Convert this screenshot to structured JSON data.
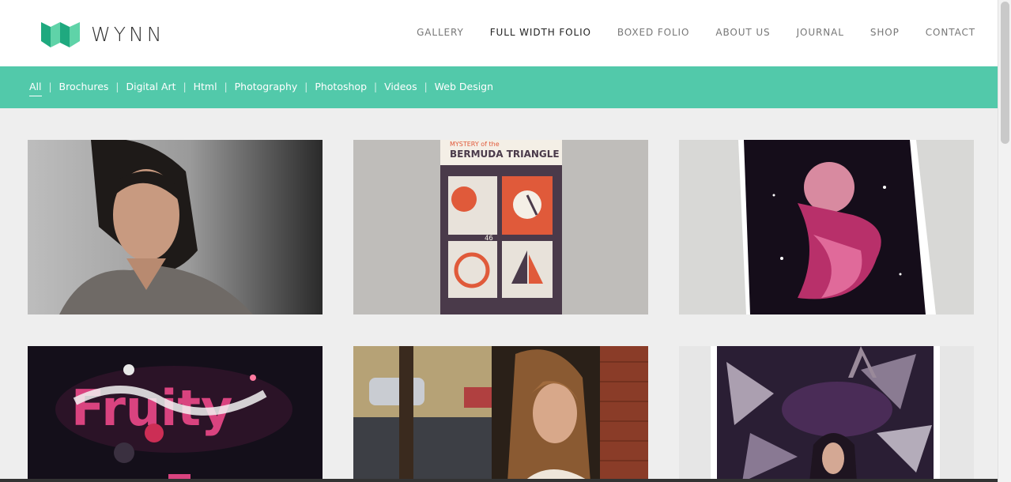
{
  "brand": {
    "name": "WYNN",
    "accent": "#52c9aa",
    "logo_dark": "#1fa97f"
  },
  "nav": {
    "items": [
      {
        "label": "GALLERY",
        "active": false
      },
      {
        "label": "FULL WIDTH FOLIO",
        "active": true
      },
      {
        "label": "BOXED FOLIO",
        "active": false
      },
      {
        "label": "ABOUT US",
        "active": false
      },
      {
        "label": "JOURNAL",
        "active": false
      },
      {
        "label": "SHOP",
        "active": false
      },
      {
        "label": "CONTACT",
        "active": false
      }
    ]
  },
  "filters": {
    "items": [
      {
        "label": "All",
        "active": true
      },
      {
        "label": "Brochures"
      },
      {
        "label": "Digital Art"
      },
      {
        "label": "Html"
      },
      {
        "label": "Photography"
      },
      {
        "label": "Photoshop"
      },
      {
        "label": "Videos"
      },
      {
        "label": "Web Design"
      }
    ]
  },
  "portfolio": {
    "items": [
      {
        "subject": "woman-portrait"
      },
      {
        "subject": "stamp-poster",
        "poster_title": "BERMUDA TRIANGLE",
        "poster_kicker": "MYSTERY of the",
        "stamp_value": "46"
      },
      {
        "subject": "framed-digital-art"
      },
      {
        "subject": "fruity-typography",
        "art_text": "Fruity"
      },
      {
        "subject": "woman-by-brick-wall"
      },
      {
        "subject": "framed-cosmic-art"
      }
    ]
  }
}
